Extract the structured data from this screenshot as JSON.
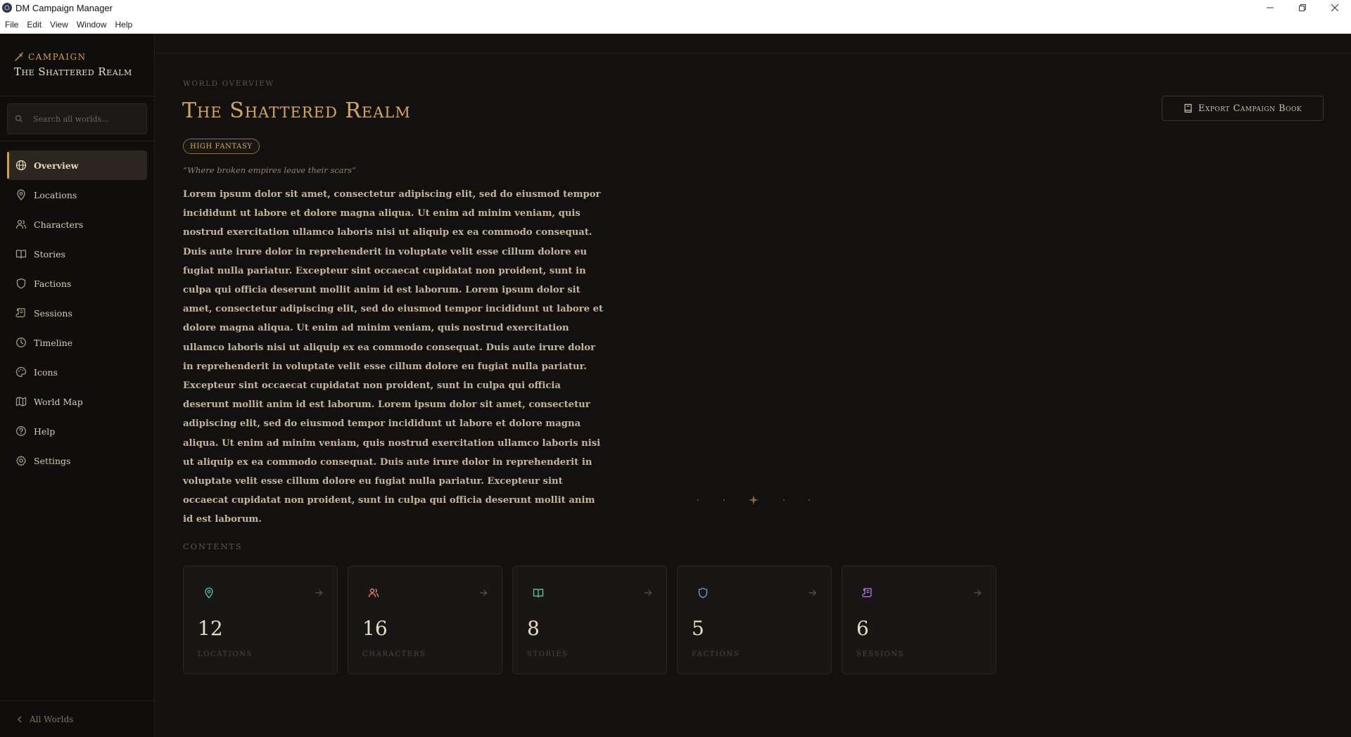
{
  "window": {
    "title": "DM Campaign Manager",
    "controls": [
      "minimize",
      "restore",
      "close"
    ]
  },
  "menu": [
    "File",
    "Edit",
    "View",
    "Window",
    "Help"
  ],
  "sidebar": {
    "campaign_label": "Campaign",
    "campaign_name": "The Shattered Realm",
    "search_placeholder": "Search all worlds...",
    "items": [
      {
        "label": "Overview",
        "icon": "globe-icon",
        "active": true
      },
      {
        "label": "Locations",
        "icon": "map-pin-icon"
      },
      {
        "label": "Characters",
        "icon": "users-icon"
      },
      {
        "label": "Stories",
        "icon": "book-open-icon"
      },
      {
        "label": "Factions",
        "icon": "shield-icon"
      },
      {
        "label": "Sessions",
        "icon": "scroll-icon"
      },
      {
        "label": "Timeline",
        "icon": "clock-icon"
      },
      {
        "label": "Icons",
        "icon": "palette-icon"
      },
      {
        "label": "World Map",
        "icon": "map-icon"
      },
      {
        "label": "Help",
        "icon": "help-circle-icon"
      },
      {
        "label": "Settings",
        "icon": "gear-icon"
      }
    ],
    "footer_label": "All Worlds"
  },
  "main": {
    "overline": "World Overview",
    "title": "The Shattered Realm",
    "export_label": "Export Campaign Book",
    "genre": "HIGH FANTASY",
    "tagline": "“Where broken empires leave their scars”",
    "description": "Lorem ipsum dolor sit amet, consectetur adipiscing elit, sed do eiusmod tempor incididunt ut labore et dolore magna aliqua. Ut enim ad minim veniam, quis nostrud exercitation ullamco laboris nisi ut aliquip ex ea commodo consequat. Duis aute irure dolor in reprehenderit in voluptate velit esse cillum dolore eu fugiat nulla pariatur. Excepteur sint occaecat cupidatat non proident, sunt in culpa qui officia deserunt mollit anim id est laborum. Lorem ipsum dolor sit amet, consectetur adipiscing elit, sed do eiusmod tempor incididunt ut labore et dolore magna aliqua. Ut enim ad minim veniam, quis nostrud exercitation ullamco laboris nisi ut aliquip ex ea commodo consequat. Duis aute irure dolor in reprehenderit in voluptate velit esse cillum dolore eu fugiat nulla pariatur. Excepteur sint occaecat cupidatat non proident, sunt in culpa qui officia deserunt mollit anim id est laborum. Lorem ipsum dolor sit amet, consectetur adipiscing elit, sed do eiusmod tempor incididunt ut labore et dolore magna aliqua. Ut enim ad minim veniam, quis nostrud exercitation ullamco laboris nisi ut aliquip ex ea commodo consequat. Duis aute irure dolor in reprehenderit in voluptate velit esse cillum dolore eu fugiat nulla pariatur. Excepteur sint occaecat cupidatat non proident, sunt in culpa qui officia deserunt mollit anim id est laborum.",
    "contents_label": "Contents",
    "cards": [
      {
        "count": "12",
        "label": "Locations",
        "icon": "map-pin-icon",
        "color": "#4fb3a6"
      },
      {
        "count": "16",
        "label": "Characters",
        "icon": "users-icon",
        "color": "#d9835a"
      },
      {
        "count": "8",
        "label": "Stories",
        "icon": "book-open-icon",
        "color": "#5bbf8a"
      },
      {
        "count": "5",
        "label": "Factions",
        "icon": "shield-icon",
        "color": "#6b9bd6"
      },
      {
        "count": "6",
        "label": "Sessions",
        "icon": "scroll-icon",
        "color": "#b27be0"
      }
    ]
  },
  "colors": {
    "accent": "#c9a24a",
    "background": "#121110",
    "sidebar": "#0f0e0d"
  }
}
